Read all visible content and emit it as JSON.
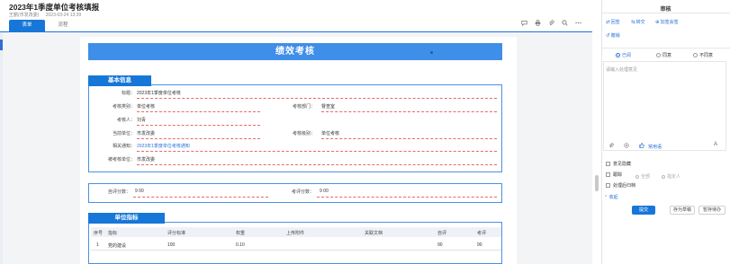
{
  "header": {
    "title": "2023年1季度单位考核填报",
    "creator": "王鹏(市发改委)",
    "datetime": "2023-03-24 13:39",
    "tabs": [
      {
        "label": "表单",
        "active": true
      },
      {
        "label": "流程",
        "active": false
      }
    ],
    "toolbar_icons": [
      "comment-icon",
      "print-icon",
      "attachment-icon",
      "search-icon",
      "more-icon"
    ]
  },
  "form": {
    "banner_title": "绩效考核",
    "basic_info": {
      "section_title": "基本信息",
      "title_label": "标题：",
      "title_value": "2023年1季度单位考核",
      "category_label": "考核类别：",
      "category_value": "单位考核",
      "department_label": "考核部门：",
      "department_value": "督查室",
      "assessor_label": "考核人：",
      "assessor_value": "刘青",
      "current_unit_label": "当前单位：",
      "current_unit_value": "市发改委",
      "level_label": "考核级别：",
      "level_value": "单位考核",
      "notice_label": "相关通知：",
      "notice_value": "2023年1季度单位考核通知",
      "assessed_unit_label": "被考核单位：",
      "assessed_unit_value": "市发改委"
    },
    "scores": {
      "self_label": "自评分数：",
      "self_value": "9  00",
      "review_label": "考评分数：",
      "review_value": "9  00"
    },
    "indicators": {
      "section_title": "单位指标",
      "columns": [
        "序号",
        "指标",
        "评分标准",
        "权重",
        "上传附件",
        "关联文档",
        "自评",
        "考评"
      ],
      "rows": [
        {
          "no": "1",
          "indicator": "党的建设",
          "standard": "100",
          "weight": "0.10",
          "attachment": "",
          "doc": "",
          "self": "90",
          "review": "90"
        }
      ]
    }
  },
  "panel": {
    "title": "审核",
    "actions": [
      "回签",
      "转交",
      "加签会签",
      "撤销"
    ],
    "decision_options": [
      {
        "label": "已阅",
        "selected": true
      },
      {
        "label": "同意",
        "selected": false
      },
      {
        "label": "不同意",
        "selected": false
      }
    ],
    "opinion_placeholder": "请输入处理意见",
    "common_phrases": "常用语",
    "font_icon": "A",
    "options": {
      "memo_label": "意见隐藏",
      "track_label": "跟踪",
      "track_all": "全部",
      "track_designated": "指定人",
      "archive_label": "处理后归档"
    },
    "collapse_label": "收起",
    "buttons": {
      "submit": "提交",
      "save_draft": "存为草稿",
      "hold": "暂存待办"
    }
  },
  "colors": {
    "accent": "#1677d8",
    "banner": "#3f8ee8",
    "underline": "#e46a6a"
  }
}
